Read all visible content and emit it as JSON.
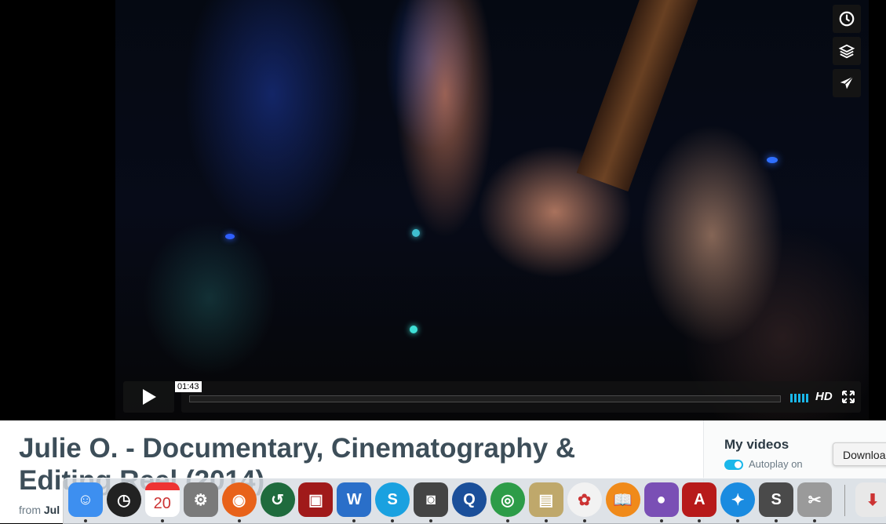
{
  "player": {
    "timecode": "01:43",
    "quality_label": "HD",
    "progress": 0.0,
    "side_buttons": [
      {
        "icon": "clock-icon",
        "name": "watch-later-button"
      },
      {
        "icon": "layers-icon",
        "name": "collections-button"
      },
      {
        "icon": "paper-plane-icon",
        "name": "share-button"
      }
    ],
    "accent_color": "#1ab7ea"
  },
  "video_page": {
    "title": "Julie O. - Documentary, Cinematography & Editing Reel (2014)",
    "from_label": "from",
    "author_partial": "Jul"
  },
  "sidebar": {
    "heading": "My videos",
    "autoplay_label": "Autoplay on",
    "autoplay_on": true
  },
  "tooltip": {
    "text": "Download"
  },
  "dock": {
    "apps": [
      {
        "name": "Finder",
        "icon": "finder-icon",
        "color": "#3d8ff0",
        "glyph": "☺",
        "running": true
      },
      {
        "name": "Dashboard",
        "icon": "dashboard-icon",
        "color": "#222",
        "glyph": "◷",
        "running": false
      },
      {
        "name": "Calendar",
        "icon": "calendar-icon",
        "color": "#fff",
        "glyph": "20",
        "running": true
      },
      {
        "name": "System Preferences",
        "icon": "gear-icon",
        "color": "#7a7a7a",
        "glyph": "⚙",
        "running": false
      },
      {
        "name": "Firefox",
        "icon": "firefox-icon",
        "color": "#e8621a",
        "glyph": "◉",
        "running": true
      },
      {
        "name": "Time Machine",
        "icon": "time-machine-icon",
        "color": "#1f6b3d",
        "glyph": "↺",
        "running": false
      },
      {
        "name": "Photo Booth",
        "icon": "photo-booth-icon",
        "color": "#a01a1a",
        "glyph": "▣",
        "running": false
      },
      {
        "name": "Word",
        "icon": "word-icon",
        "color": "#2a6fc9",
        "glyph": "W",
        "running": true
      },
      {
        "name": "Skype",
        "icon": "skype-icon",
        "color": "#1aa1e0",
        "glyph": "S",
        "running": true
      },
      {
        "name": "Image Capture",
        "icon": "camera-icon",
        "color": "#444",
        "glyph": "◙",
        "running": true
      },
      {
        "name": "QuickTime",
        "icon": "quicktime-icon",
        "color": "#1b4f9a",
        "glyph": "Q",
        "running": false
      },
      {
        "name": "Chrome",
        "icon": "chrome-icon",
        "color": "#2d9c48",
        "glyph": "◎",
        "running": true
      },
      {
        "name": "Preview",
        "icon": "preview-icon",
        "color": "#bfa86b",
        "glyph": "▤",
        "running": true
      },
      {
        "name": "Photos",
        "icon": "photos-icon",
        "color": "#f2f2f2",
        "glyph": "✿",
        "running": true
      },
      {
        "name": "iBooks",
        "icon": "ibooks-icon",
        "color": "#f08a1a",
        "glyph": "📖",
        "running": false
      },
      {
        "name": "GitHub",
        "icon": "github-icon",
        "color": "#7a4fb5",
        "glyph": "●",
        "running": true
      },
      {
        "name": "Acrobat",
        "icon": "acrobat-icon",
        "color": "#b71a1a",
        "glyph": "A",
        "running": true
      },
      {
        "name": "Safari",
        "icon": "safari-icon",
        "color": "#1a8be0",
        "glyph": "✦",
        "running": true
      },
      {
        "name": "Sublime Text",
        "icon": "sublime-icon",
        "color": "#4a4a4a",
        "glyph": "S",
        "running": true
      },
      {
        "name": "Script Editor",
        "icon": "scissors-icon",
        "color": "#9a9a9a",
        "glyph": "✂",
        "running": true
      },
      {
        "name": "Downloads",
        "icon": "downloads-icon",
        "color": "#e8e8e8",
        "glyph": "⬇",
        "running": false
      }
    ]
  }
}
